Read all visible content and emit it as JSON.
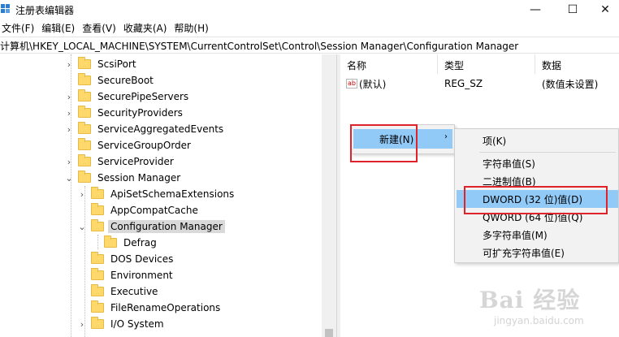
{
  "window": {
    "title": "注册表编辑器",
    "minimize_glyph": "—",
    "maximize_glyph": "☐",
    "close_glyph": "✕"
  },
  "menu": [
    "文件(F)",
    "编辑(E)",
    "查看(V)",
    "收藏夹(A)",
    "帮助(H)"
  ],
  "address": "计算机\\HKEY_LOCAL_MACHINE\\SYSTEM\\CurrentControlSet\\Control\\Session Manager\\Configuration Manager",
  "tree": [
    {
      "label": "ScsiPort",
      "chevron": "›"
    },
    {
      "label": "SecureBoot",
      "chevron": ""
    },
    {
      "label": "SecurePipeServers",
      "chevron": "›"
    },
    {
      "label": "SecurityProviders",
      "chevron": "›"
    },
    {
      "label": "ServiceAggregatedEvents",
      "chevron": "›"
    },
    {
      "label": "ServiceGroupOrder",
      "chevron": ""
    },
    {
      "label": "ServiceProvider",
      "chevron": "›"
    },
    {
      "label": "Session Manager",
      "chevron": "⌄"
    },
    {
      "label": "ApiSetSchemaExtensions",
      "chevron": "›"
    },
    {
      "label": "AppCompatCache",
      "chevron": ""
    },
    {
      "label": "Configuration Manager",
      "chevron": "⌄"
    },
    {
      "label": "Defrag",
      "chevron": ""
    },
    {
      "label": "DOS Devices",
      "chevron": ""
    },
    {
      "label": "Environment",
      "chevron": ""
    },
    {
      "label": "Executive",
      "chevron": ""
    },
    {
      "label": "FileRenameOperations",
      "chevron": ""
    },
    {
      "label": "I/O System",
      "chevron": "›"
    }
  ],
  "list": {
    "headers": {
      "name": "名称",
      "type": "类型",
      "data": "数据"
    },
    "rows": [
      {
        "icon": "ab",
        "name": "(默认)",
        "type": "REG_SZ",
        "data": "(数值未设置)"
      }
    ]
  },
  "context_menu": {
    "new_label": "新建(N)",
    "arrow": "›"
  },
  "submenu": {
    "items": [
      "项(K)",
      "字符串值(S)",
      "二进制值(B)",
      "DWORD (32 位)值(D)",
      "QWORD (64 位)值(Q)",
      "多字符串值(M)",
      "可扩充字符串值(E)"
    ]
  },
  "watermark": {
    "big": "Bai 经验",
    "small": "jingyan.baidu.com"
  },
  "colors": {
    "highlight": "#91c9f7",
    "annotation_red": "#e0232a",
    "folder": "#ffd86c"
  }
}
